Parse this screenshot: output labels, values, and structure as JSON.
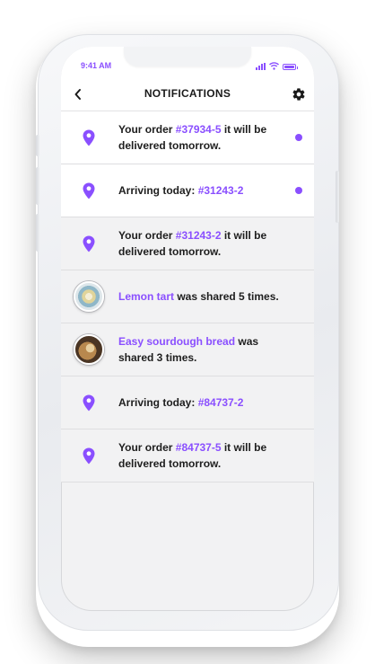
{
  "status_bar": {
    "time": "9:41 AM"
  },
  "header": {
    "title": "NOTIFICATIONS",
    "back_icon": "chevron-left-icon",
    "settings_icon": "gear-icon"
  },
  "colors": {
    "accent": "#8a4fff",
    "unread_bg": "#ffffff",
    "read_bg": "#f2f2f3",
    "text": "#1e1e1e"
  },
  "notifications": [
    {
      "icon": "location-pin-icon",
      "unread": true,
      "line_a": "Your order ",
      "link": "#37934-5",
      "line_b": " it will be delivered tomorrow."
    },
    {
      "icon": "location-pin-icon",
      "unread": true,
      "line_a": "Arriving today: ",
      "link": "#31243-2",
      "line_b": ""
    },
    {
      "icon": "location-pin-icon",
      "unread": false,
      "line_a": "Your order ",
      "link": "#31243-2",
      "line_b": " it will be delivered tomorrow."
    },
    {
      "icon": "lemon-tart-avatar",
      "unread": false,
      "line_a": "",
      "link": "Lemon tart",
      "line_b": " was shared 5 times."
    },
    {
      "icon": "sourdough-bread-avatar",
      "unread": false,
      "line_a": "",
      "link": "Easy sourdough bread",
      "line_b": " was shared 3 times."
    },
    {
      "icon": "location-pin-icon",
      "unread": false,
      "line_a": "Arriving today: ",
      "link": "#84737-2",
      "line_b": ""
    },
    {
      "icon": "location-pin-icon",
      "unread": false,
      "line_a": "Your order ",
      "link": "#84737-5",
      "line_b": " it will be delivered tomorrow."
    }
  ]
}
